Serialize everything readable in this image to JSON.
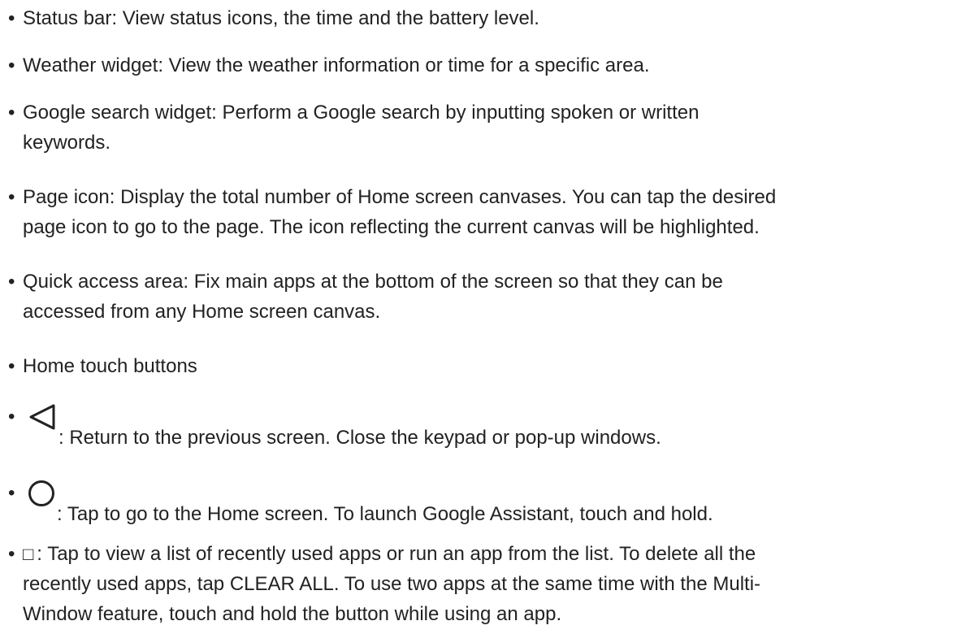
{
  "items": [
    {
      "text": "Status bar: View status icons, the time and the battery level."
    },
    {
      "text": "Weather widget: View the weather information or time for a specific area."
    },
    {
      "line1": "Google search widget: Perform a Google search by inputting spoken or written",
      "line2": "keywords."
    },
    {
      "line1": "Page icon: Display the total number of Home screen canvases. You can tap the desired",
      "line2": "page icon to go to the page. The icon reflecting the current canvas will be highlighted."
    },
    {
      "line1": "Quick access area: Fix main apps at the bottom of the screen so that they can be",
      "line2": "accessed from any Home screen canvas."
    },
    {
      "text": "Home touch buttons"
    },
    {
      "icon": "back-triangle-icon",
      "text": ": Return to the previous screen. Close the keypad or pop-up windows."
    },
    {
      "icon": "home-circle-icon",
      "text": ": Tap to go to the Home screen. To launch Google Assistant, touch and hold."
    },
    {
      "glyph": "□",
      "line1": ": Tap to view a list of recently used apps or run an app from the list. To delete all the",
      "line2": "recently used apps, tap CLEAR ALL. To use two apps at the same time with the Multi-",
      "line3": "Window feature, touch and hold the button while using an app."
    }
  ],
  "bullet": "•"
}
